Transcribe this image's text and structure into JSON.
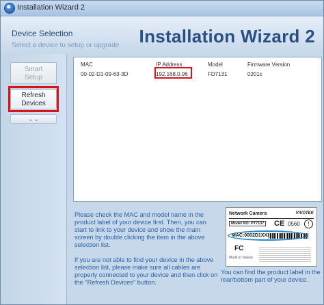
{
  "window": {
    "title": "Installation Wizard 2"
  },
  "header": {
    "section_title": "Device Selection",
    "section_subtitle": "Select a device to setup or upgrade",
    "big_title": "Installation Wizard 2"
  },
  "sidebar": {
    "smart_setup_line1": "Smart",
    "smart_setup_line2": "Setup",
    "refresh_line1": "Refresh",
    "refresh_line2": "Devices",
    "expand_icon": "chevron-double-down-icon"
  },
  "device_list": {
    "columns": [
      "MAC",
      "IP Address",
      "Model",
      "Firmware Version"
    ],
    "rows": [
      {
        "mac": "00-02-D1-09-63-3D",
        "ip": "192.168.0.96",
        "model": "FD7131",
        "firmware": "0201c"
      }
    ]
  },
  "instructions": {
    "paragraph1": "Please check the MAC and model name in the product label of your device first. Then, you can start to link to your device and show the main screen by double clicking the item in the above selection list.",
    "paragraph2": "If you are not able to find your device in the above selection list, please make sure all cables are properly connected to your device and then click on the \"Refresh Devices\" button."
  },
  "product_label": {
    "title": "Network Camera",
    "brand": "VIVOTEK",
    "model": "Model NO: PT7137",
    "ce": "CE",
    "number": "0560",
    "alert": "!",
    "mac": "MAC:0002D1XXXXXX",
    "fc": "FC",
    "made_in": "Made in Taiwan",
    "caption": "You can find the product label in the rear/bottom part of your device."
  },
  "colors": {
    "highlight_red": "#d7141a",
    "oval_blue": "#2b8ac6",
    "instruction_text": "#2861a8",
    "title_blue": "#2a4f86"
  }
}
